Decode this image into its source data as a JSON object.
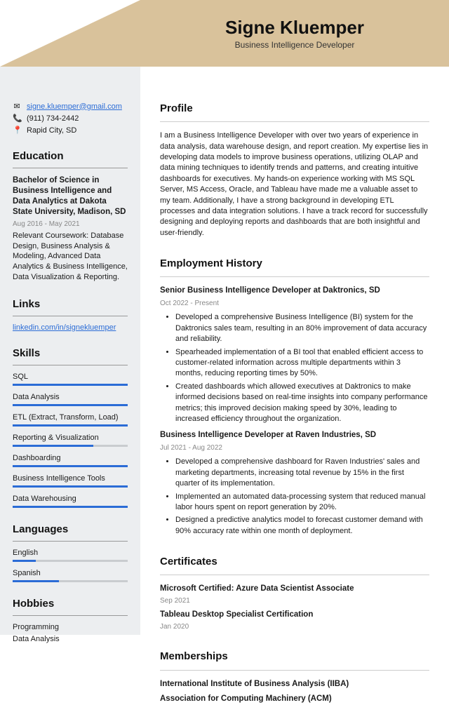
{
  "header": {
    "name": "Signe Kluemper",
    "subtitle": "Business Intelligence Developer"
  },
  "contact": {
    "email": "signe.kluemper@gmail.com",
    "phone": "(911) 734-2442",
    "location": "Rapid City, SD"
  },
  "education": {
    "section": "Education",
    "title": "Bachelor of Science in Business Intelligence and Data Analytics at Dakota State University, Madison, SD",
    "dates": "Aug 2016 - May 2021",
    "body": "Relevant Coursework: Database Design, Business Analysis & Modeling, Advanced Data Analytics & Business Intelligence, Data Visualization & Reporting."
  },
  "links": {
    "section": "Links",
    "items": [
      "linkedin.com/in/signekluemper"
    ]
  },
  "skills": {
    "section": "Skills",
    "items": [
      {
        "name": "SQL",
        "pct": 100
      },
      {
        "name": "Data Analysis",
        "pct": 100
      },
      {
        "name": "ETL (Extract, Transform, Load)",
        "pct": 100
      },
      {
        "name": "Reporting & Visualization",
        "pct": 70
      },
      {
        "name": "Dashboarding",
        "pct": 100
      },
      {
        "name": "Business Intelligence Tools",
        "pct": 100
      },
      {
        "name": "Data Warehousing",
        "pct": 100
      }
    ]
  },
  "languages": {
    "section": "Languages",
    "items": [
      {
        "name": "English",
        "pct": 20
      },
      {
        "name": "Spanish",
        "pct": 40
      }
    ]
  },
  "hobbies": {
    "section": "Hobbies",
    "items": [
      "Programming",
      "Data Analysis"
    ]
  },
  "profile": {
    "section": "Profile",
    "text": "I am a Business Intelligence Developer with over two years of experience in data analysis, data warehouse design, and report creation. My expertise lies in developing data models to improve business operations, utilizing OLAP and data mining techniques to identify trends and patterns, and creating intuitive dashboards for executives. My hands-on experience working with MS SQL Server, MS Access, Oracle, and Tableau have made me a valuable asset to my team. Additionally, I have a strong background in developing ETL processes and data integration solutions. I have a track record for successfully designing and deploying reports and dashboards that are both insightful and user-friendly."
  },
  "employment": {
    "section": "Employment History",
    "jobs": [
      {
        "title": "Senior Business Intelligence Developer at Daktronics, SD",
        "dates": "Oct 2022 - Present",
        "bullets": [
          "Developed a comprehensive Business Intelligence (BI) system for the Daktronics sales team, resulting in an 80% improvement of data accuracy and reliability.",
          "Spearheaded implementation of a BI tool that enabled efficient access to customer-related information across multiple departments within 3 months, reducing reporting times by 50%.",
          "Created dashboards which allowed executives at Daktronics to make informed decisions based on real-time insights into company performance metrics; this improved decision making speed by 30%, leading to increased efficiency throughout the organization."
        ]
      },
      {
        "title": "Business Intelligence Developer at Raven Industries, SD",
        "dates": "Jul 2021 - Aug 2022",
        "bullets": [
          "Developed a comprehensive dashboard for Raven Industries' sales and marketing departments, increasing total revenue by 15% in the first quarter of its implementation.",
          "Implemented an automated data-processing system that reduced manual labor hours spent on report generation by 20%.",
          "Designed a predictive analytics model to forecast customer demand with 90% accuracy rate within one month of deployment."
        ]
      }
    ]
  },
  "certificates": {
    "section": "Certificates",
    "items": [
      {
        "title": "Microsoft Certified: Azure Data Scientist Associate",
        "date": "Sep 2021"
      },
      {
        "title": "Tableau Desktop Specialist Certification",
        "date": "Jan 2020"
      }
    ]
  },
  "memberships": {
    "section": "Memberships",
    "items": [
      "International Institute of Business Analysis (IIBA)",
      "Association for Computing Machinery (ACM)"
    ]
  }
}
